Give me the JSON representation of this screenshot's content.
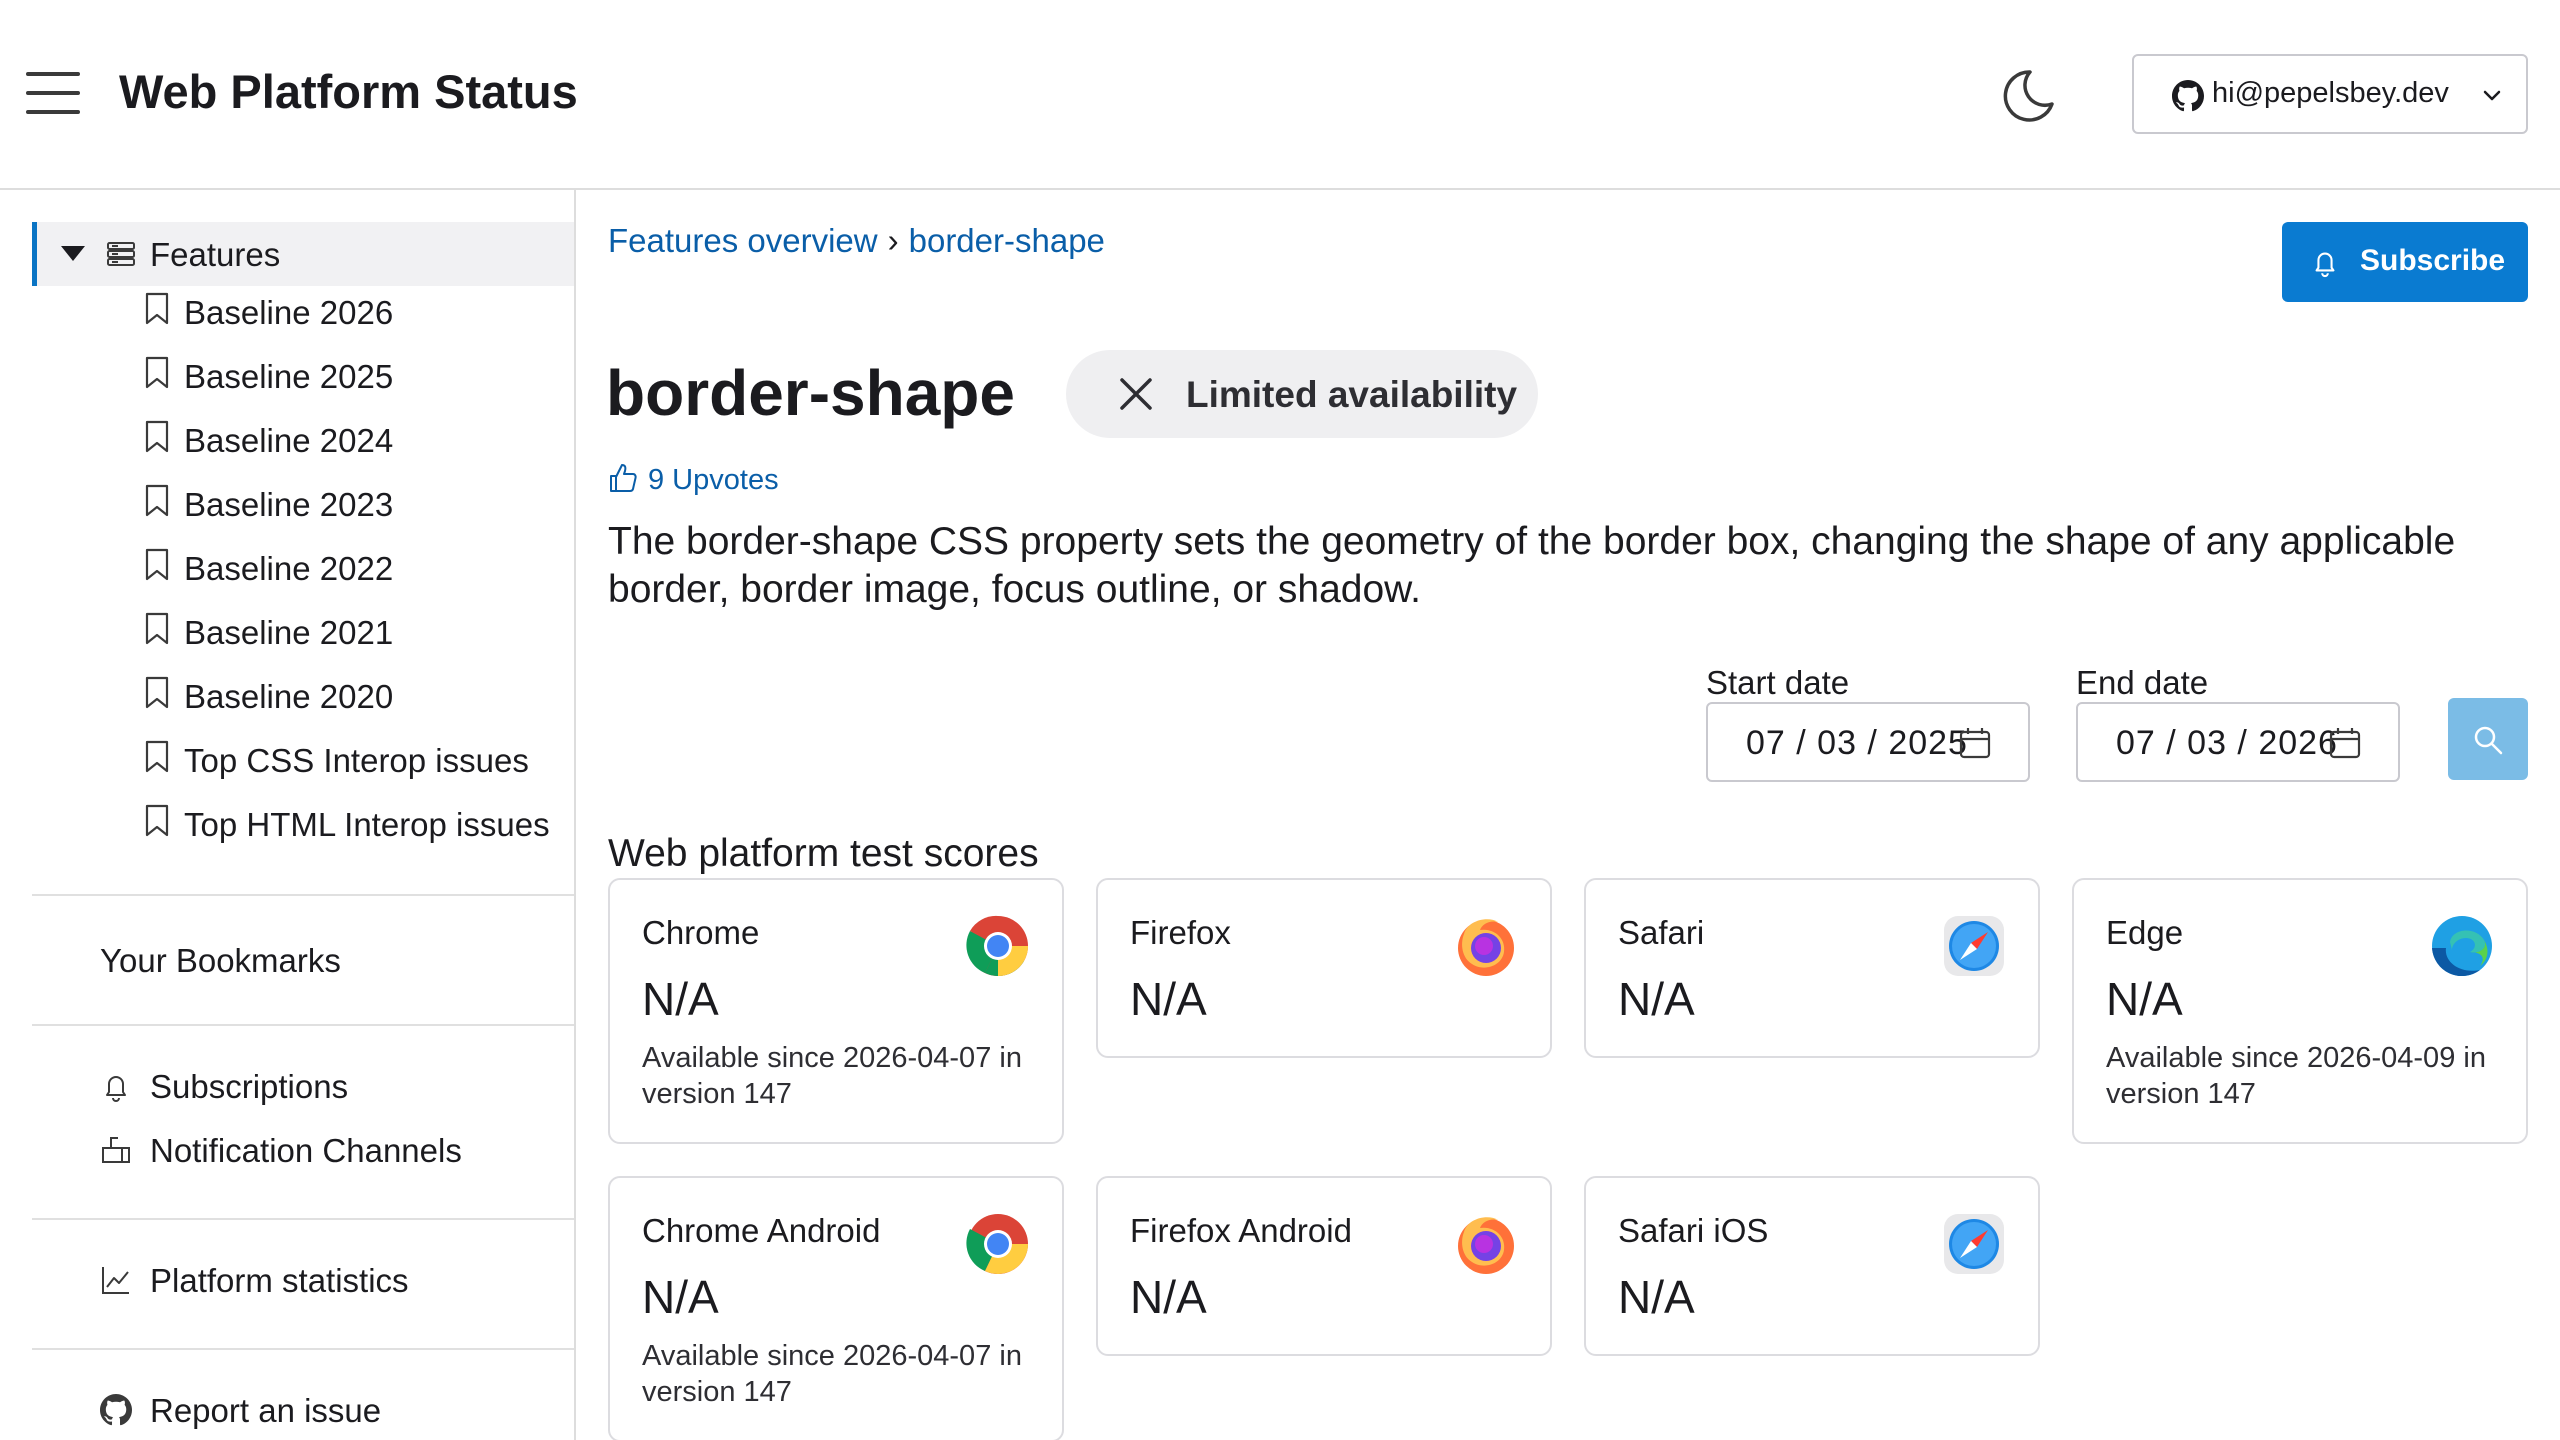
{
  "header": {
    "title": "Web Platform Status",
    "account_email": "hi@pepelsbey.dev",
    "icons": {
      "menu": "hamburger-menu-icon",
      "theme": "moon-icon",
      "account": "github-icon",
      "dropdown": "chevron-down-icon"
    }
  },
  "sidebar": {
    "features_label": "Features",
    "baseline_items": [
      {
        "label": "Baseline 2026"
      },
      {
        "label": "Baseline 2025"
      },
      {
        "label": "Baseline 2024"
      },
      {
        "label": "Baseline 2023"
      },
      {
        "label": "Baseline 2022"
      },
      {
        "label": "Baseline 2021"
      },
      {
        "label": "Baseline 2020"
      },
      {
        "label": "Top CSS Interop issues"
      },
      {
        "label": "Top HTML Interop issues"
      }
    ],
    "bookmarks_label": "Your Bookmarks",
    "subscriptions_label": "Subscriptions",
    "notification_channels_label": "Notification Channels",
    "platform_statistics_label": "Platform statistics",
    "report_issue_label": "Report an issue"
  },
  "breadcrumb": {
    "root": "Features overview",
    "separator": "›",
    "current": "border-shape"
  },
  "subscribe_label": "Subscribe",
  "feature": {
    "name": "border-shape",
    "availability": "Limited availability",
    "upvotes": "9 Upvotes",
    "description": "The border-shape CSS property sets the geometry of the border box, changing the shape of any applicable border, border image, focus outline, or shadow."
  },
  "date_range": {
    "start_label": "Start date",
    "start_value": "07 / 03 / 2025",
    "end_label": "End date",
    "end_value": "07 / 03 / 2026"
  },
  "scores": {
    "title": "Web platform test scores",
    "cards": [
      {
        "browser": "Chrome",
        "score": "N/A",
        "since": "Available since 2026-04-07 in version 147",
        "icon": "chrome-logo-icon"
      },
      {
        "browser": "Firefox",
        "score": "N/A",
        "since": "",
        "icon": "firefox-logo-icon"
      },
      {
        "browser": "Safari",
        "score": "N/A",
        "since": "",
        "icon": "safari-logo-icon"
      },
      {
        "browser": "Edge",
        "score": "N/A",
        "since": "Available since 2026-04-09 in version 147",
        "icon": "edge-logo-icon"
      },
      {
        "browser": "Chrome Android",
        "score": "N/A",
        "since": "Available since 2026-04-07 in version 147",
        "icon": "chrome-logo-icon"
      },
      {
        "browser": "Firefox Android",
        "score": "N/A",
        "since": "",
        "icon": "firefox-logo-icon"
      },
      {
        "browser": "Safari iOS",
        "score": "N/A",
        "since": "",
        "icon": "safari-logo-icon"
      }
    ]
  },
  "colors": {
    "accent": "#0a7bd1",
    "link": "#0a5ea8",
    "search_button": "#7bbce6",
    "active_border": "#0a74c4"
  }
}
